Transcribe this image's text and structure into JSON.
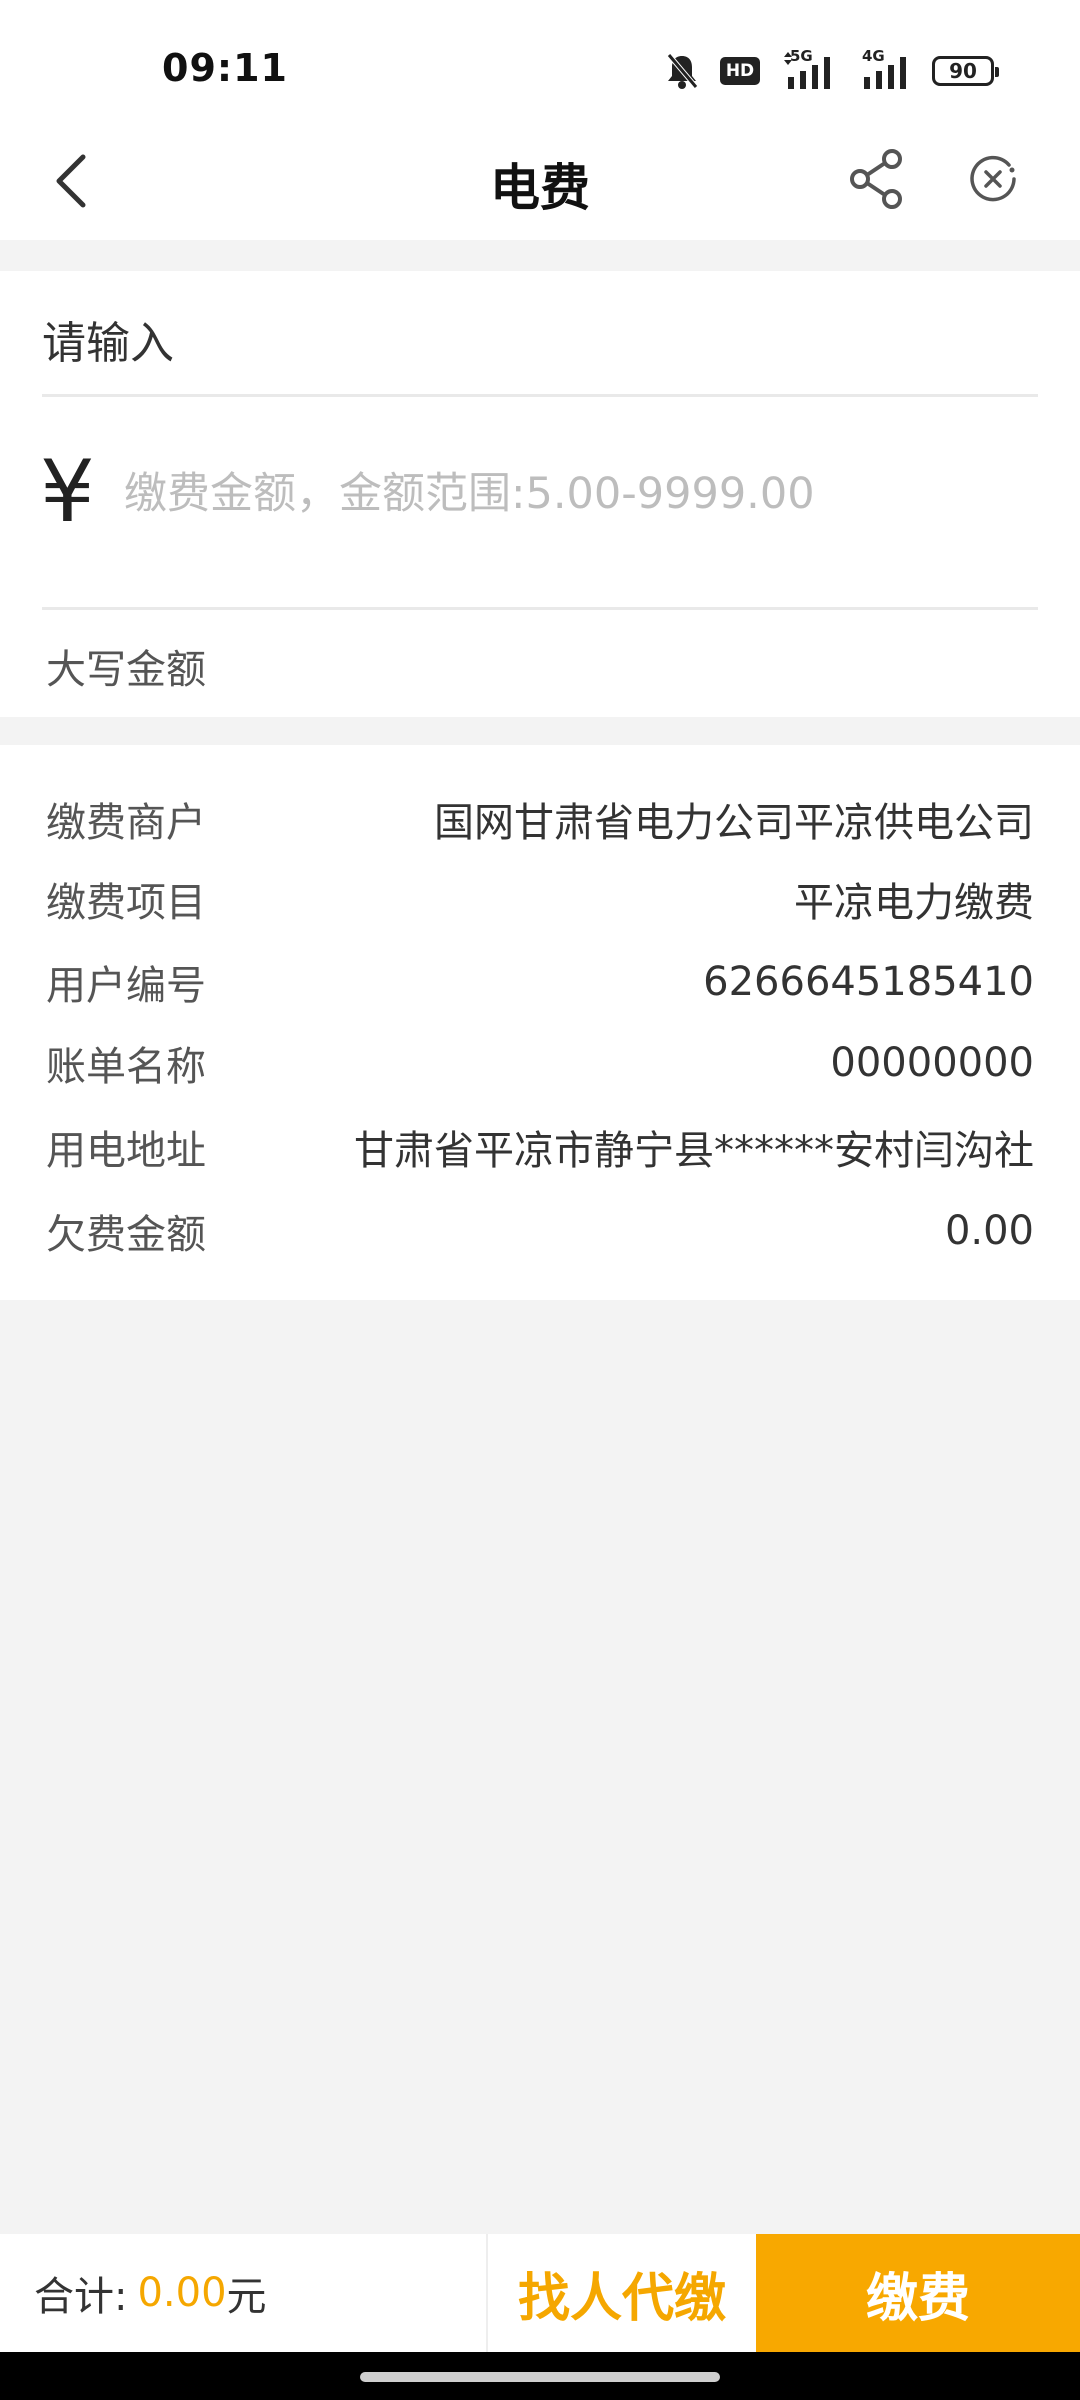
{
  "status_bar": {
    "time": "09:11",
    "hd_label": "HD",
    "net_5g": "5G",
    "net_4g": "4G",
    "battery": "90"
  },
  "nav": {
    "title": "电费"
  },
  "form": {
    "account_placeholder": "请输入",
    "currency_symbol": "¥",
    "amount_placeholder": "缴费金额，金额范围:5.00-9999.00",
    "uppercase_label": "大写金额"
  },
  "info": {
    "rows": [
      {
        "label": "缴费商户",
        "value": "国网甘肃省电力公司平凉供电公司"
      },
      {
        "label": "缴费项目",
        "value": "平凉电力缴费"
      },
      {
        "label": "用户编号",
        "value": "6266645185410"
      },
      {
        "label": "账单名称",
        "value": "00000000"
      },
      {
        "label": "用电地址",
        "value": "甘肃省平凉市静宁县******安村闫沟社"
      },
      {
        "label": "欠费金额",
        "value": "0.00"
      }
    ]
  },
  "bottom": {
    "total_label": "合计:",
    "total_amount": "0.00",
    "total_unit": "元",
    "proxy_pay_label": "找人代缴",
    "pay_label": "缴费"
  },
  "colors": {
    "accent": "#f8a800",
    "page_background": "#f3f3f3"
  }
}
